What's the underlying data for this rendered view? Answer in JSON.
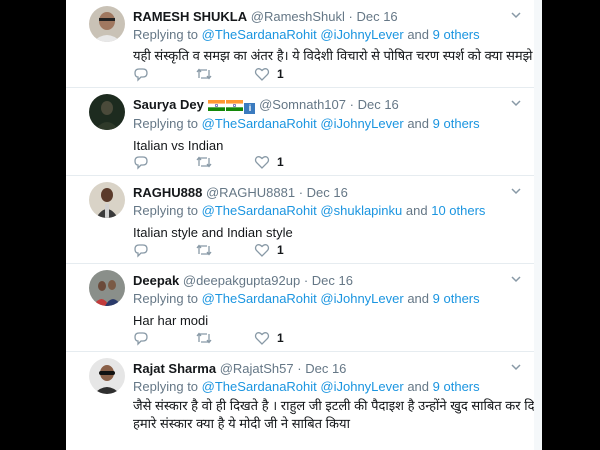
{
  "labels": {
    "replying_to": "Replying to",
    "and": "and"
  },
  "tweets": [
    {
      "name": "RAMESH SHUKLA",
      "handle": "@RameshShukl",
      "dot": "·",
      "date": "Dec 16",
      "replying": [
        "@TheSardanaRohit",
        "@iJohnyLever"
      ],
      "others": "9 others",
      "text_lines": [
        "यही संस्कृति व समझ का अंतर है। ये विदेशी विचारो से पोषित चरण स्पर्श को क्या समझे।"
      ],
      "likes": "1"
    },
    {
      "name": "Saurya Dey",
      "handle": "@Somnath107",
      "dot": "·",
      "date": "Dec 16",
      "replying": [
        "@TheSardanaRohit",
        "@iJohnyLever"
      ],
      "others": "9 others",
      "text_lines": [
        "Italian vs Indian"
      ],
      "likes": "1",
      "badge": "i"
    },
    {
      "name": "RAGHU888",
      "handle": "@RAGHU8881",
      "dot": "·",
      "date": "Dec 16",
      "replying": [
        "@TheSardanaRohit",
        "@shuklapinku"
      ],
      "others": "10 others",
      "text_lines": [
        "Italian style and Indian style"
      ],
      "likes": "1"
    },
    {
      "name": "Deepak",
      "handle": "@deepakgupta92up",
      "dot": "·",
      "date": "Dec 16",
      "replying": [
        "@TheSardanaRohit",
        "@iJohnyLever"
      ],
      "others": "9 others",
      "text_lines": [
        "Har har modi"
      ],
      "likes": "1"
    },
    {
      "name": "Rajat Sharma",
      "handle": "@RajatSh57",
      "dot": "·",
      "date": "Dec 16",
      "replying": [
        "@TheSardanaRohit",
        "@iJohnyLever"
      ],
      "others": "9 others",
      "text_lines": [
        "जैसे संस्कार है वो ही दिखते है । राहुल जी इटली की पैदाइश है  उन्होंने खुद साबित कर दिया ।",
        "हमारे संस्कार क्या है ये मोदी जी ने साबित किया"
      ],
      "likes": ""
    }
  ],
  "icons": {
    "reply": "reply-icon",
    "retweet": "retweet-icon",
    "like": "heart-icon",
    "caret": "chevron-down-icon"
  },
  "colors": {
    "link": "#1b95e0",
    "muted": "#657786",
    "text": "#14171a"
  }
}
